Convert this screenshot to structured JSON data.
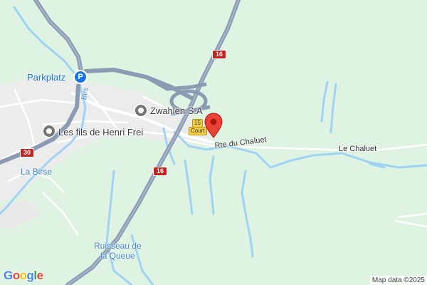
{
  "map": {
    "labels": {
      "parkplatz": "Parkplatz",
      "parking_symbol": "P",
      "zwahlen": "Zwahlen S.A",
      "fils_henri": "Les fils de Henri Frei",
      "la_birse": "La Birse",
      "birs": "Birs",
      "ruisseau": "Ruisseau de",
      "ruisseau_2": "la Queue",
      "rte_chaluet": "Rte du Chaluet",
      "le_chaluet": "Le Chaluet"
    },
    "shields": {
      "s16_top": "16",
      "s16_bottom": "16",
      "s30": "30"
    },
    "route_badge": {
      "number": "15",
      "text": "Court"
    },
    "google_logo": [
      "G",
      "o",
      "o",
      "g",
      "l",
      "e"
    ],
    "attribution": "Map data ©2025"
  },
  "colors": {
    "background": "#dff3e2",
    "urban": "#ececec",
    "major_road": "#8b9bb4",
    "water": "#9fd3f5",
    "marker": "#ea4335",
    "shield": "#c5221f",
    "parking": "#1a73e8"
  },
  "icons": {
    "marker": "map-pin-icon",
    "parking": "parking-icon",
    "poi": "poi-pin-icon"
  }
}
